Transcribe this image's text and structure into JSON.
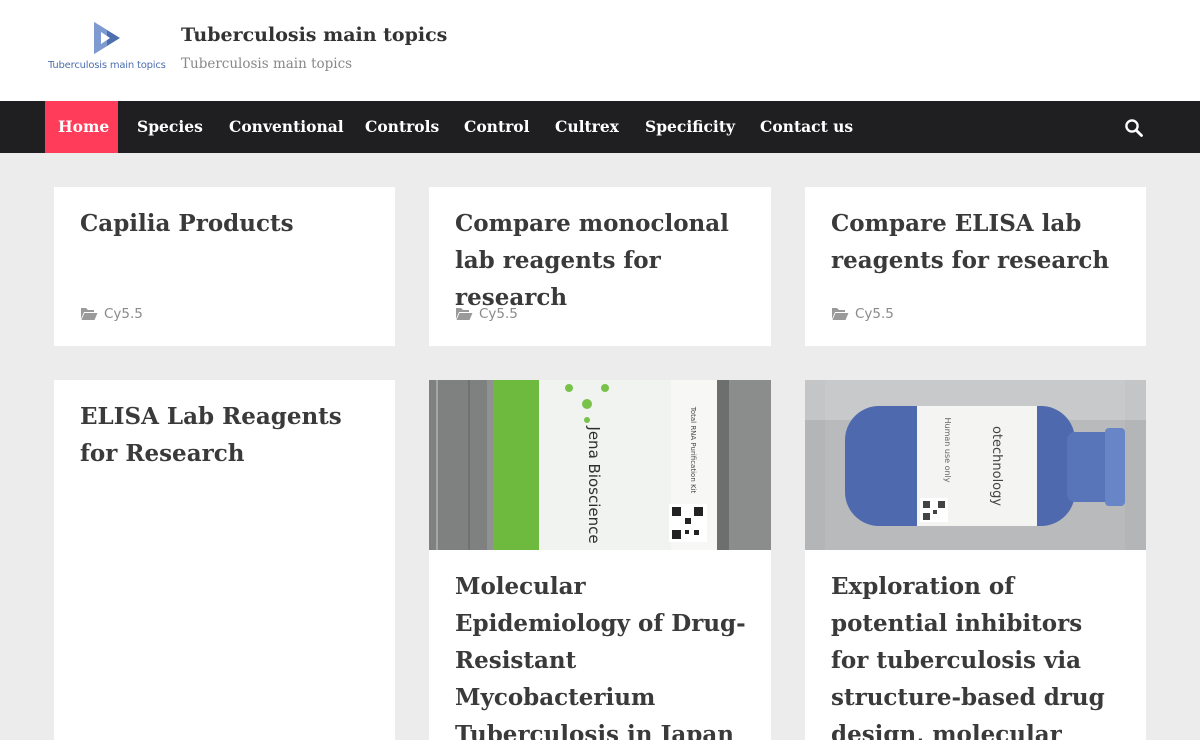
{
  "header": {
    "logo_text": "Tuberculosis main topics",
    "site_title": "Tuberculosis main topics",
    "tagline": "Tuberculosis main topics"
  },
  "nav": {
    "items": [
      {
        "label": "Home",
        "active": true
      },
      {
        "label": "Species"
      },
      {
        "label": "Conventional"
      },
      {
        "label": "Controls"
      },
      {
        "label": "Control"
      },
      {
        "label": "Cultrex"
      },
      {
        "label": "Specificity"
      },
      {
        "label": "Contact us"
      }
    ],
    "search_icon": "search-icon"
  },
  "posts": [
    {
      "title": "Capilia Products",
      "category": "Cy5.5"
    },
    {
      "title": "Compare monoclonal lab reagents for research",
      "category": "Cy5.5"
    },
    {
      "title": "Compare ELISA lab reagents for research",
      "category": "Cy5.5"
    },
    {
      "title": "ELISA Lab Reagents for Research"
    },
    {
      "title": "Molecular Epidemiology of Drug-Resistant Mycobacterium Tuberculosis in Japan",
      "image": {
        "brand": "Jena Bioscience",
        "label": "Total RNA Purification Kit"
      }
    },
    {
      "title": "Exploration of potential inhibitors for tuberculosis via structure-based drug design, molecular",
      "image": {
        "brand": "otechnology",
        "label": "Human use only"
      }
    }
  ],
  "colors": {
    "accent": "#ff3d5a",
    "navbar": "#1f1f21",
    "background": "#ececec"
  }
}
